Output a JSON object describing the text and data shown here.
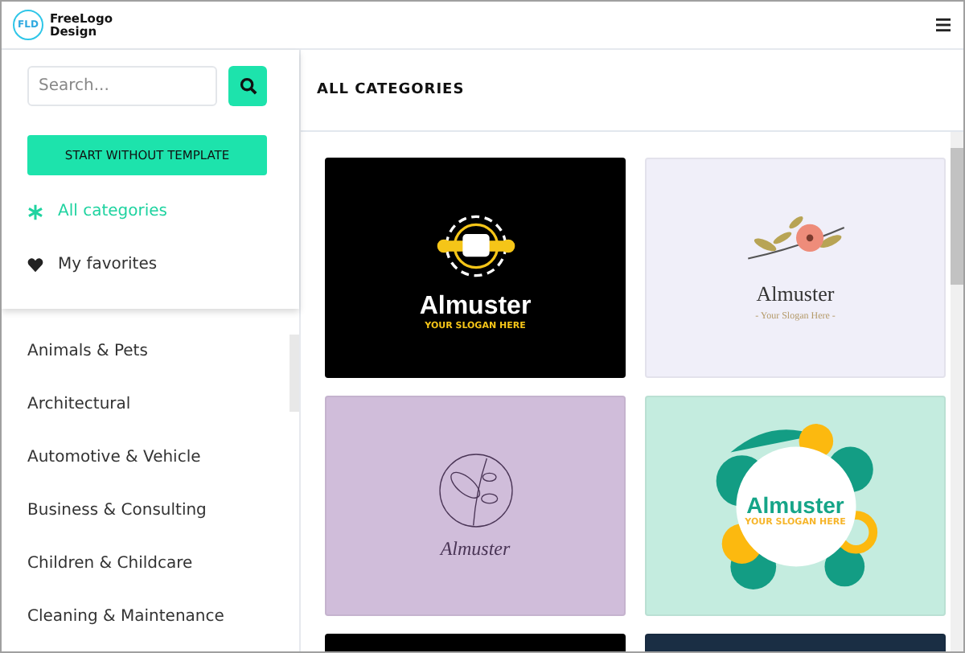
{
  "header": {
    "logo_badge": "FLD",
    "logo_text": "FreeLogo Design"
  },
  "panel": {
    "search": {
      "placeholder": "Search..."
    },
    "start_button": "START WITHOUT TEMPLATE",
    "menu": [
      {
        "kind": "asterisk",
        "label": "All categories",
        "selected": true
      },
      {
        "kind": "heart",
        "label": "My favorites",
        "selected": false
      }
    ]
  },
  "categories": [
    "Animals & Pets",
    "Architectural",
    "Automotive & Vehicle",
    "Business & Consulting",
    "Children & Childcare",
    "Cleaning & Maintenance"
  ],
  "main": {
    "title": "ALL CATEGORIES",
    "cards": [
      {
        "kind": "gear",
        "color": "#000000",
        "name": "Almuster",
        "slogan": "YOUR SLOGAN HERE"
      },
      {
        "kind": "floral",
        "color": "#f0eff9",
        "name": "Almuster",
        "slogan": "- Your Slogan Here -"
      },
      {
        "kind": "botanical",
        "color": "#d0bdda",
        "name": "Almuster"
      },
      {
        "kind": "tropical",
        "color": "#c4ecdf",
        "name": "Almuster",
        "slogan": "YOUR SLOGAN HERE"
      },
      {
        "kind": "plain",
        "color": "#000000"
      },
      {
        "kind": "plain",
        "color": "#1a2e44"
      }
    ]
  }
}
